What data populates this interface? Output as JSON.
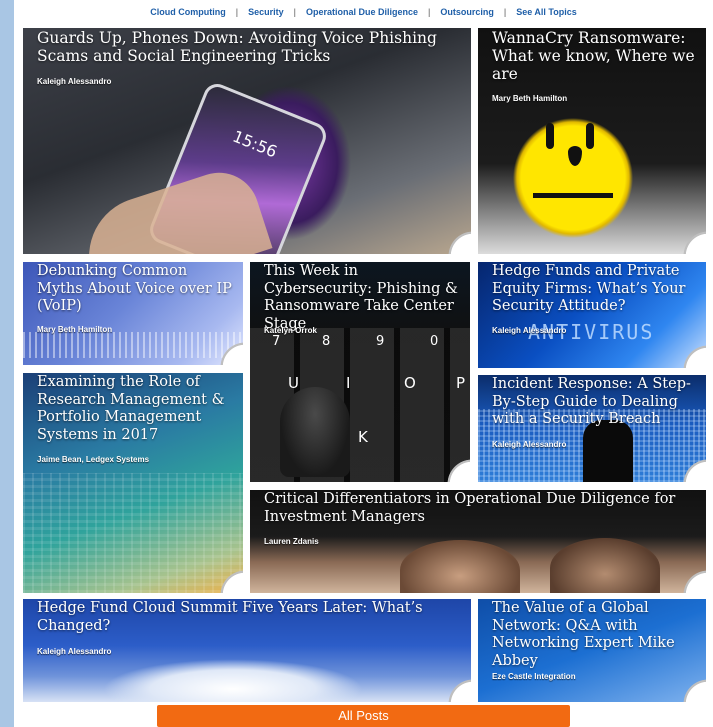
{
  "nav": {
    "items": [
      "Cloud Computing",
      "Security",
      "Operational Due Diligence",
      "Outsourcing",
      "See All Topics"
    ],
    "separator": "|"
  },
  "tiles": [
    {
      "title": "Guards Up, Phones Down: Avoiding Voice Phishing Scams and Social Engineering Tricks",
      "author": "Kaleigh Alessandro"
    },
    {
      "title": "WannaCry Ransomware: What we know, Where we are",
      "author": "Mary Beth Hamilton"
    },
    {
      "title": "Debunking Common Myths About Voice over IP (VoIP)",
      "author": "Mary Beth Hamilton"
    },
    {
      "title": "This Week in Cybersecurity: Phishing & Ransomware Take Center Stage",
      "author": "Katelyn Orrok"
    },
    {
      "title": "Hedge Funds and Private Equity Firms: What’s Your Security Attitude?",
      "author": "Kaleigh Alessandro"
    },
    {
      "title": "Examining the Role of Research Management & Portfolio Management Systems in 2017",
      "author": "Jaime Bean, Ledgex Systems"
    },
    {
      "title": "Incident Response: A Step-By-Step Guide to Dealing with a Security Breach",
      "author": "Kaleigh Alessandro"
    },
    {
      "title": "Critical Differentiators in Operational Due Diligence for Investment Managers",
      "author": "Lauren Zdanis"
    },
    {
      "title": "Hedge Fund Cloud Summit Five Years Later: What’s Changed?",
      "author": "Kaleigh Alessandro"
    },
    {
      "title": "The Value of a Global Network: Q&A with Networking Expert Mike Abbey",
      "author": "Eze Castle Integration"
    }
  ],
  "image_text": {
    "phone_time": "15:56",
    "antivirus": "ANTIVIRUS",
    "keys": [
      "7",
      "8",
      "9",
      "0",
      "U",
      "I",
      "O",
      "P",
      "K"
    ]
  },
  "all_posts_label": "All Posts"
}
